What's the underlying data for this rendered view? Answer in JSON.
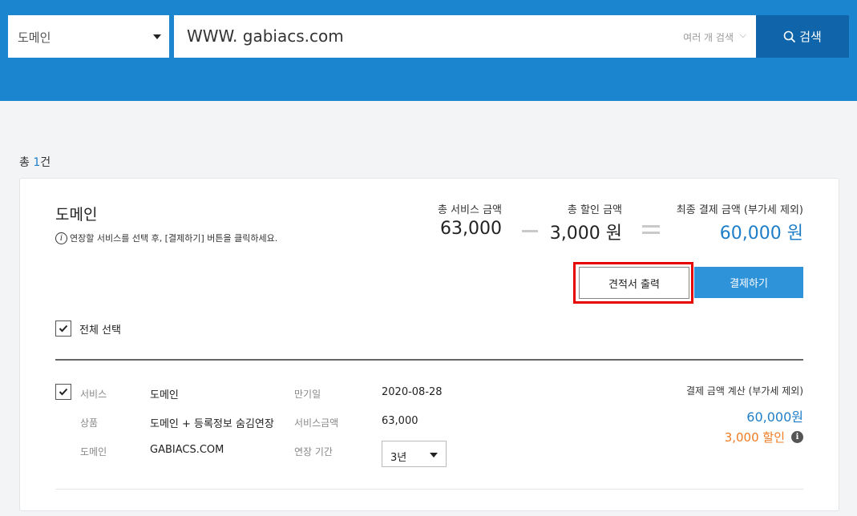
{
  "search": {
    "type_select": "도메인",
    "query": "WWW. gabiacs.com",
    "multi_search": "여러 개 검색",
    "button": "검색"
  },
  "results": {
    "total_prefix": "총 ",
    "total_count": "1",
    "total_suffix": "건"
  },
  "card": {
    "title": "도메인",
    "info_text": "연장할 서비스를 선택 후, [결제하기] 버튼을 클릭하세요.",
    "summary": {
      "service_label": "총 서비스 금액",
      "service_value": "63,000",
      "discount_label": "총 할인 금액",
      "discount_value": "3,000 원",
      "final_label": "최종 결제 금액 (부가세 제외)",
      "final_value": "60,000 원"
    },
    "buttons": {
      "quote": "견적서 출력",
      "pay": "결제하기"
    },
    "select_all": "전체 선택",
    "item": {
      "service_key": "서비스",
      "service_val": "도메인",
      "product_key": "상품",
      "product_val": "도메인 + 등록정보 숨김연장",
      "domain_key": "도메인",
      "domain_val": "GABIACS.COM",
      "expiry_key": "만기일",
      "expiry_val": "2020-08-28",
      "amount_key": "서비스금액",
      "amount_val": "63,000",
      "period_key": "연장 기간",
      "period_val": "3년",
      "calc_title": "결제 금액 계산 (부가세 제외)",
      "calc_price": "60,000원",
      "calc_discount": "3,000 할인"
    }
  },
  "colors": {
    "header_blue": "#1b86cf",
    "search_button": "#0f64aa",
    "pay_button": "#2e93d9",
    "accent_blue": "#1e7ec8",
    "discount_orange": "#f07b22",
    "highlight_red": "#e60000"
  },
  "icons": [
    "search-icon",
    "chevron-down-icon",
    "info-icon",
    "check-icon"
  ]
}
